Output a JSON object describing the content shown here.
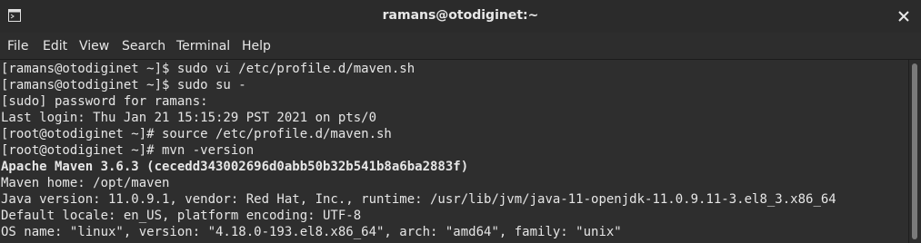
{
  "window": {
    "title": "ramans@otodiginet:~",
    "icon": "terminal-icon",
    "close_icon": "close-icon"
  },
  "menu": [
    "File",
    "Edit",
    "View",
    "Search",
    "Terminal",
    "Help"
  ],
  "terminal": {
    "lines": [
      {
        "text": "[ramans@otodiginet ~]$ sudo vi /etc/profile.d/maven.sh",
        "bold": false
      },
      {
        "text": "[ramans@otodiginet ~]$ sudo su -",
        "bold": false
      },
      {
        "text": "[sudo] password for ramans:",
        "bold": false
      },
      {
        "text": "Last login: Thu Jan 21 15:15:29 PST 2021 on pts/0",
        "bold": false
      },
      {
        "text": "[root@otodiginet ~]# source /etc/profile.d/maven.sh",
        "bold": false
      },
      {
        "text": "[root@otodiginet ~]# mvn -version",
        "bold": false
      },
      {
        "text": "Apache Maven 3.6.3 (cecedd343002696d0abb50b32b541b8a6ba2883f)",
        "bold": true
      },
      {
        "text": "Maven home: /opt/maven",
        "bold": false
      },
      {
        "text": "Java version: 11.0.9.1, vendor: Red Hat, Inc., runtime: /usr/lib/jvm/java-11-openjdk-11.0.9.11-3.el8_3.x86_64",
        "bold": false
      },
      {
        "text": "Default locale: en_US, platform encoding: UTF-8",
        "bold": false
      },
      {
        "text": "OS name: \"linux\", version: \"4.18.0-193.el8.x86_64\", arch: \"amd64\", family: \"unix\"",
        "bold": false
      }
    ]
  },
  "colors": {
    "titlebar": "#2b2b2b",
    "background": "#2e2e2e",
    "text": "#e6e6e6"
  }
}
